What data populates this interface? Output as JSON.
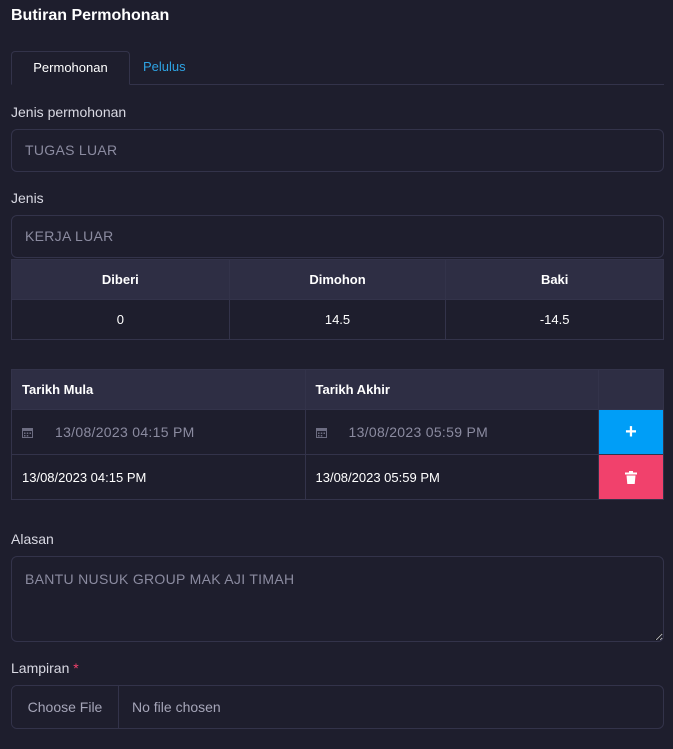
{
  "page_title": "Butiran Permohonan",
  "tabs": [
    {
      "label": "Permohonan",
      "active": true
    },
    {
      "label": "Pelulus",
      "active": false
    }
  ],
  "jenis_permohonan": {
    "label": "Jenis permohonan",
    "value": "TUGAS LUAR"
  },
  "jenis": {
    "label": "Jenis",
    "value": "KERJA LUAR"
  },
  "balance_table": {
    "headers": [
      "Diberi",
      "Dimohon",
      "Baki"
    ],
    "row": [
      "0",
      "14.5",
      "-14.5"
    ]
  },
  "dates_table": {
    "headers": [
      "Tarikh Mula",
      "Tarikh Akhir"
    ],
    "input_row": {
      "start": "13/08/2023 04:15 PM",
      "end": "13/08/2023 05:59 PM",
      "action": "+"
    },
    "rows": [
      {
        "start": "13/08/2023 04:15 PM",
        "end": "13/08/2023 05:59 PM"
      }
    ]
  },
  "alasan": {
    "label": "Alasan",
    "value": "BANTU NUSUK GROUP MAK AJI TIMAH"
  },
  "lampiran": {
    "label": "Lampiran",
    "required_mark": "*",
    "button": "Choose File",
    "status": "No file chosen"
  },
  "colors": {
    "background": "#1e1e2d",
    "accent_blue": "#009ef7",
    "danger": "#f1416c",
    "link": "#2ea3e3",
    "header_bg": "#2e2e44"
  }
}
